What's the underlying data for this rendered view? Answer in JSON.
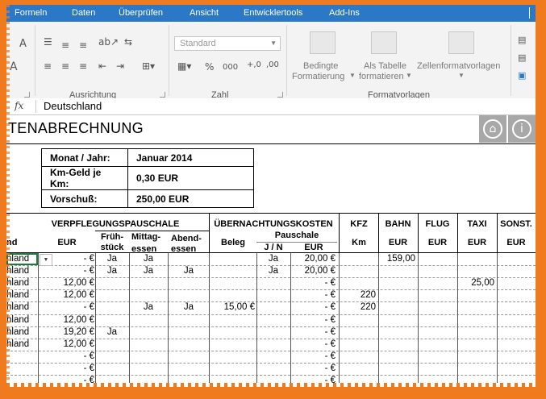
{
  "menu": [
    "Formeln",
    "Daten",
    "Überprüfen",
    "Ansicht",
    "Entwicklertools",
    "Add-Ins"
  ],
  "ribbon": {
    "font_group_letters": [
      "A",
      "A"
    ],
    "alignment_group": "Ausrichtung",
    "number_format_value": "Standard",
    "percent_symbol": "%",
    "thousands_symbol": "000",
    "number_group": "Zahl",
    "cond_format_line1": "Bedingte",
    "cond_format_line2": "Formatierung",
    "as_table_line1": "Als Tabelle",
    "as_table_line2": "formatieren",
    "cell_styles": "Zellenformatvorlagen",
    "styles_group": "Formatvorlagen"
  },
  "formula_bar": {
    "fx": "fx",
    "value": "Deutschland"
  },
  "sheet": {
    "title": "TENABRECHNUNG",
    "info": [
      {
        "label": "Monat / Jahr:",
        "value": "Januar 2014"
      },
      {
        "label": "Km-Geld je Km:",
        "value": "0,30 EUR"
      },
      {
        "label": "Vorschuß:",
        "value": "250,00 EUR"
      }
    ],
    "headers": {
      "verpflegung": "VERPFLEGUNGSPAUSCHALE",
      "uebernachtung": "ÜBERNACHTUNGSKOSTEN",
      "kfz": "KFZ",
      "bahn": "BAHN",
      "flug": "FLUG",
      "taxi": "TAXI",
      "sonst": "SONST.",
      "land": "nd",
      "eur": "EUR",
      "frueh1": "Früh-",
      "frueh2": "stück",
      "mittag1": "Mittag-",
      "mittag2": "essen",
      "abend1": "Abend-",
      "abend2": "essen",
      "beleg": "Beleg",
      "pauschale": "Pauschale",
      "jn": "J / N",
      "eur2": "EUR",
      "km": "Km",
      "bahn_eur": "EUR",
      "flug_eur": "EUR",
      "taxi_eur": "EUR",
      "sonst_eur": "EUR"
    },
    "rows": [
      {
        "land": "hland",
        "eur": "-   €",
        "fr": "Ja",
        "mi": "Ja",
        "ab": "",
        "beleg": "",
        "jn": "Ja",
        "p": "20,00 €",
        "km": "",
        "bahn": "159,00",
        "flug": "",
        "taxi": "",
        "sonst": ""
      },
      {
        "land": "hland",
        "eur": "-   €",
        "fr": "Ja",
        "mi": "Ja",
        "ab": "Ja",
        "beleg": "",
        "jn": "Ja",
        "p": "20,00 €",
        "km": "",
        "bahn": "",
        "flug": "",
        "taxi": "",
        "sonst": ""
      },
      {
        "land": "hland",
        "eur": "12,00 €",
        "fr": "",
        "mi": "",
        "ab": "",
        "beleg": "",
        "jn": "",
        "p": "-   €",
        "km": "",
        "bahn": "",
        "flug": "",
        "taxi": "25,00",
        "sonst": ""
      },
      {
        "land": "hland",
        "eur": "12,00 €",
        "fr": "",
        "mi": "",
        "ab": "",
        "beleg": "",
        "jn": "",
        "p": "-   €",
        "km": "220",
        "bahn": "",
        "flug": "",
        "taxi": "",
        "sonst": ""
      },
      {
        "land": "hland",
        "eur": "-   €",
        "fr": "",
        "mi": "Ja",
        "ab": "Ja",
        "beleg": "15,00 €",
        "jn": "",
        "p": "-   €",
        "km": "220",
        "bahn": "",
        "flug": "",
        "taxi": "",
        "sonst": ""
      },
      {
        "land": "hland",
        "eur": "12,00 €",
        "fr": "",
        "mi": "",
        "ab": "",
        "beleg": "",
        "jn": "",
        "p": "-   €",
        "km": "",
        "bahn": "",
        "flug": "",
        "taxi": "",
        "sonst": ""
      },
      {
        "land": "hland",
        "eur": "19,20 €",
        "fr": "Ja",
        "mi": "",
        "ab": "",
        "beleg": "",
        "jn": "",
        "p": "-   €",
        "km": "",
        "bahn": "",
        "flug": "",
        "taxi": "",
        "sonst": ""
      },
      {
        "land": "hland",
        "eur": "12,00 €",
        "fr": "",
        "mi": "",
        "ab": "",
        "beleg": "",
        "jn": "",
        "p": "-   €",
        "km": "",
        "bahn": "",
        "flug": "",
        "taxi": "",
        "sonst": ""
      },
      {
        "land": "",
        "eur": "-   €",
        "fr": "",
        "mi": "",
        "ab": "",
        "beleg": "",
        "jn": "",
        "p": "-   €",
        "km": "",
        "bahn": "",
        "flug": "",
        "taxi": "",
        "sonst": ""
      },
      {
        "land": "",
        "eur": "-   €",
        "fr": "",
        "mi": "",
        "ab": "",
        "beleg": "",
        "jn": "",
        "p": "-   €",
        "km": "",
        "bahn": "",
        "flug": "",
        "taxi": "",
        "sonst": ""
      },
      {
        "land": "",
        "eur": "-   €",
        "fr": "",
        "mi": "",
        "ab": "",
        "beleg": "",
        "jn": "",
        "p": "-   €",
        "km": "",
        "bahn": "",
        "flug": "",
        "taxi": "",
        "sonst": ""
      }
    ]
  }
}
